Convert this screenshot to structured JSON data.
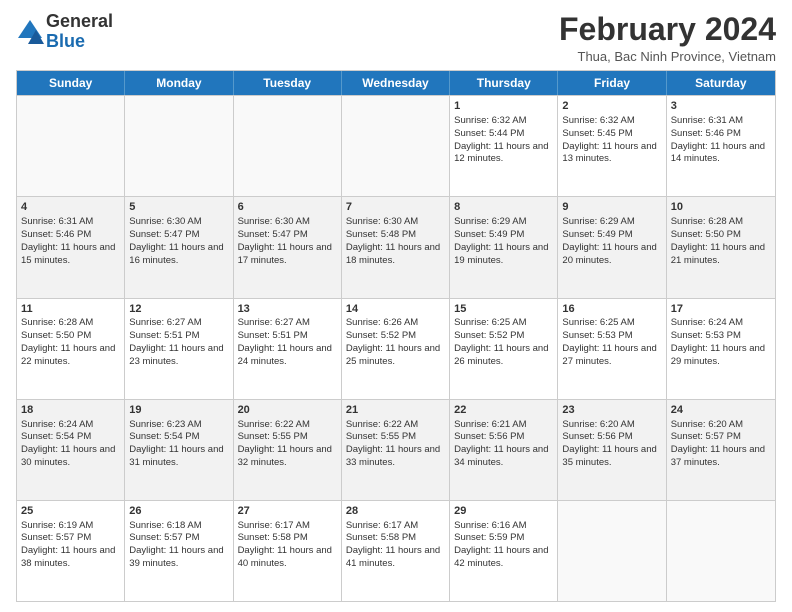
{
  "header": {
    "logo_general": "General",
    "logo_blue": "Blue",
    "month_year": "February 2024",
    "location": "Thua, Bac Ninh Province, Vietnam"
  },
  "days_of_week": [
    "Sunday",
    "Monday",
    "Tuesday",
    "Wednesday",
    "Thursday",
    "Friday",
    "Saturday"
  ],
  "weeks": [
    [
      {
        "day": "",
        "info": ""
      },
      {
        "day": "",
        "info": ""
      },
      {
        "day": "",
        "info": ""
      },
      {
        "day": "",
        "info": ""
      },
      {
        "day": "1",
        "info": "Sunrise: 6:32 AM\nSunset: 5:44 PM\nDaylight: 11 hours and 12 minutes."
      },
      {
        "day": "2",
        "info": "Sunrise: 6:32 AM\nSunset: 5:45 PM\nDaylight: 11 hours and 13 minutes."
      },
      {
        "day": "3",
        "info": "Sunrise: 6:31 AM\nSunset: 5:46 PM\nDaylight: 11 hours and 14 minutes."
      }
    ],
    [
      {
        "day": "4",
        "info": "Sunrise: 6:31 AM\nSunset: 5:46 PM\nDaylight: 11 hours and 15 minutes."
      },
      {
        "day": "5",
        "info": "Sunrise: 6:30 AM\nSunset: 5:47 PM\nDaylight: 11 hours and 16 minutes."
      },
      {
        "day": "6",
        "info": "Sunrise: 6:30 AM\nSunset: 5:47 PM\nDaylight: 11 hours and 17 minutes."
      },
      {
        "day": "7",
        "info": "Sunrise: 6:30 AM\nSunset: 5:48 PM\nDaylight: 11 hours and 18 minutes."
      },
      {
        "day": "8",
        "info": "Sunrise: 6:29 AM\nSunset: 5:49 PM\nDaylight: 11 hours and 19 minutes."
      },
      {
        "day": "9",
        "info": "Sunrise: 6:29 AM\nSunset: 5:49 PM\nDaylight: 11 hours and 20 minutes."
      },
      {
        "day": "10",
        "info": "Sunrise: 6:28 AM\nSunset: 5:50 PM\nDaylight: 11 hours and 21 minutes."
      }
    ],
    [
      {
        "day": "11",
        "info": "Sunrise: 6:28 AM\nSunset: 5:50 PM\nDaylight: 11 hours and 22 minutes."
      },
      {
        "day": "12",
        "info": "Sunrise: 6:27 AM\nSunset: 5:51 PM\nDaylight: 11 hours and 23 minutes."
      },
      {
        "day": "13",
        "info": "Sunrise: 6:27 AM\nSunset: 5:51 PM\nDaylight: 11 hours and 24 minutes."
      },
      {
        "day": "14",
        "info": "Sunrise: 6:26 AM\nSunset: 5:52 PM\nDaylight: 11 hours and 25 minutes."
      },
      {
        "day": "15",
        "info": "Sunrise: 6:25 AM\nSunset: 5:52 PM\nDaylight: 11 hours and 26 minutes."
      },
      {
        "day": "16",
        "info": "Sunrise: 6:25 AM\nSunset: 5:53 PM\nDaylight: 11 hours and 27 minutes."
      },
      {
        "day": "17",
        "info": "Sunrise: 6:24 AM\nSunset: 5:53 PM\nDaylight: 11 hours and 29 minutes."
      }
    ],
    [
      {
        "day": "18",
        "info": "Sunrise: 6:24 AM\nSunset: 5:54 PM\nDaylight: 11 hours and 30 minutes."
      },
      {
        "day": "19",
        "info": "Sunrise: 6:23 AM\nSunset: 5:54 PM\nDaylight: 11 hours and 31 minutes."
      },
      {
        "day": "20",
        "info": "Sunrise: 6:22 AM\nSunset: 5:55 PM\nDaylight: 11 hours and 32 minutes."
      },
      {
        "day": "21",
        "info": "Sunrise: 6:22 AM\nSunset: 5:55 PM\nDaylight: 11 hours and 33 minutes."
      },
      {
        "day": "22",
        "info": "Sunrise: 6:21 AM\nSunset: 5:56 PM\nDaylight: 11 hours and 34 minutes."
      },
      {
        "day": "23",
        "info": "Sunrise: 6:20 AM\nSunset: 5:56 PM\nDaylight: 11 hours and 35 minutes."
      },
      {
        "day": "24",
        "info": "Sunrise: 6:20 AM\nSunset: 5:57 PM\nDaylight: 11 hours and 37 minutes."
      }
    ],
    [
      {
        "day": "25",
        "info": "Sunrise: 6:19 AM\nSunset: 5:57 PM\nDaylight: 11 hours and 38 minutes."
      },
      {
        "day": "26",
        "info": "Sunrise: 6:18 AM\nSunset: 5:57 PM\nDaylight: 11 hours and 39 minutes."
      },
      {
        "day": "27",
        "info": "Sunrise: 6:17 AM\nSunset: 5:58 PM\nDaylight: 11 hours and 40 minutes."
      },
      {
        "day": "28",
        "info": "Sunrise: 6:17 AM\nSunset: 5:58 PM\nDaylight: 11 hours and 41 minutes."
      },
      {
        "day": "29",
        "info": "Sunrise: 6:16 AM\nSunset: 5:59 PM\nDaylight: 11 hours and 42 minutes."
      },
      {
        "day": "",
        "info": ""
      },
      {
        "day": "",
        "info": ""
      }
    ]
  ]
}
